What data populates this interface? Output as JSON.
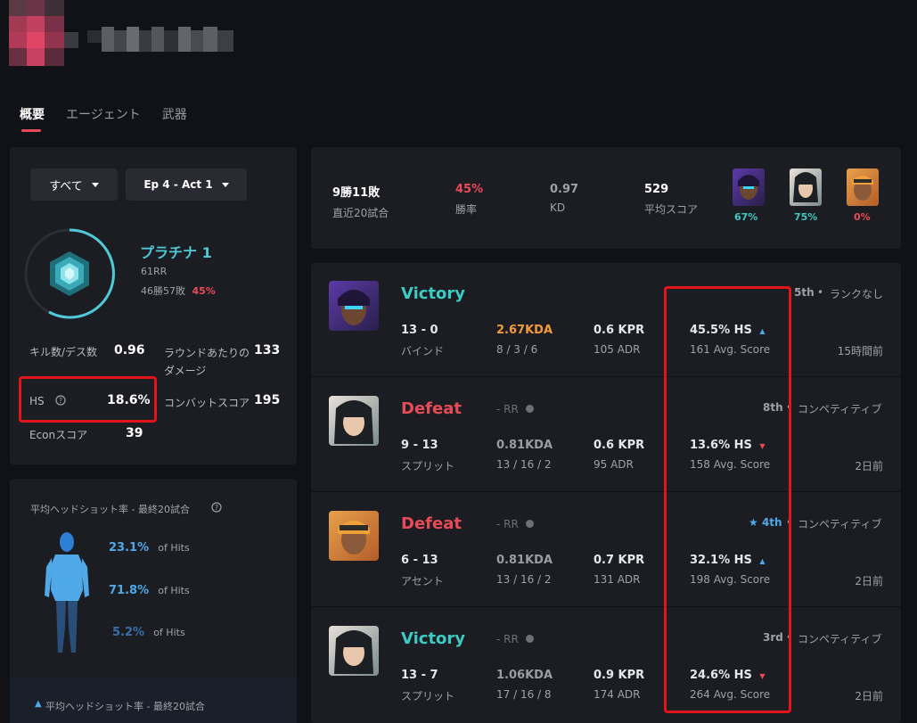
{
  "tabs": [
    {
      "label": "概要",
      "active": true
    },
    {
      "label": "エージェント",
      "active": false
    },
    {
      "label": "武器",
      "active": false
    }
  ],
  "filters": {
    "mode": "すべて",
    "act": "Ep 4 - Act 1"
  },
  "rank": {
    "name": "プラチナ 1",
    "rr": "61RR",
    "record": "46勝57敗",
    "winrate": "45%"
  },
  "stats": {
    "kd_label": "キル数/デス数",
    "kd": "0.96",
    "dmg_label": "ラウンドあたりの\nダメージ",
    "dmg": "133",
    "hs_label": "HS",
    "hs": "18.6%",
    "combat_label": "コンバットスコア",
    "combat": "195",
    "econ_label": "Econスコア",
    "econ": "39"
  },
  "headshot": {
    "title": "平均ヘッドショット率 - 最終20試合",
    "head_pct": "23.1%",
    "body_pct": "71.8%",
    "legs_pct": "5.2%",
    "of_hits": "of Hits",
    "footer": "平均ヘッドショット率 - 最終20試合"
  },
  "summary": {
    "record": "9勝11敗",
    "record_sub": "直近20試合",
    "winrate": "45%",
    "winrate_sub": "勝率",
    "kd": "0.97",
    "kd_sub": "KD",
    "score": "529",
    "score_sub": "平均スコア",
    "agents": [
      {
        "pct": "67%",
        "color": "#3ec9c2"
      },
      {
        "pct": "75%",
        "color": "#3ec9c2"
      },
      {
        "pct": "0%",
        "color": "#e84b57"
      }
    ]
  },
  "matches": [
    {
      "result": "Victory",
      "result_color": "#3ec9c2",
      "rr": "",
      "placement": "5th",
      "placement_star": false,
      "queue": "ランクなし",
      "score": "13 - 0",
      "map": "バインド",
      "kda": "2.67KDA",
      "kda_color": "#f39b3c",
      "kda_detail": "8 / 3 / 6",
      "kpr": "0.6 KPR",
      "adr": "105 ADR",
      "hs": "45.5% HS",
      "hs_trend": "up",
      "avg": "161 Avg. Score",
      "time": "15時間前"
    },
    {
      "result": "Defeat",
      "result_color": "#e84b57",
      "rr": "- RR",
      "placement": "8th",
      "placement_star": false,
      "queue": "コンペティティブ",
      "score": "9 - 13",
      "map": "スプリット",
      "kda": "0.81KDA",
      "kda_color": "#9a9ca3",
      "kda_detail": "13 / 16 / 2",
      "kpr": "0.6 KPR",
      "adr": "95 ADR",
      "hs": "13.6% HS",
      "hs_trend": "down",
      "avg": "158 Avg. Score",
      "time": "2日前"
    },
    {
      "result": "Defeat",
      "result_color": "#e84b57",
      "rr": "- RR",
      "placement": "4th",
      "placement_star": true,
      "queue": "コンペティティブ",
      "score": "6 - 13",
      "map": "アセント",
      "kda": "0.81KDA",
      "kda_color": "#9a9ca3",
      "kda_detail": "13 / 16 / 2",
      "kpr": "0.7 KPR",
      "adr": "131 ADR",
      "hs": "32.1% HS",
      "hs_trend": "up",
      "avg": "198 Avg. Score",
      "time": "2日前"
    },
    {
      "result": "Victory",
      "result_color": "#3ec9c2",
      "rr": "- RR",
      "placement": "3rd",
      "placement_star": false,
      "queue": "コンペティティブ",
      "score": "13 - 7",
      "map": "スプリット",
      "kda": "1.06KDA",
      "kda_color": "#9a9ca3",
      "kda_detail": "17 / 16 / 8",
      "kpr": "0.9 KPR",
      "adr": "174 ADR",
      "hs": "24.6% HS",
      "hs_trend": "down",
      "avg": "264 Avg. Score",
      "time": "2日前"
    }
  ]
}
